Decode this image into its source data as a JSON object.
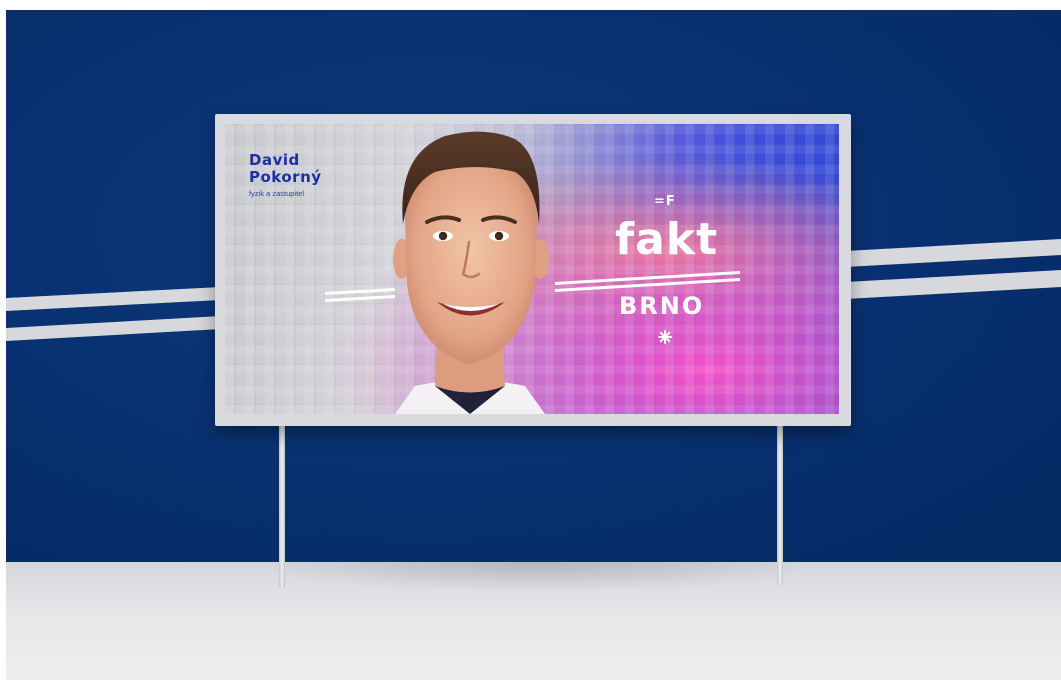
{
  "billboard": {
    "name_line_1": "David",
    "name_line_2": "Pokorný",
    "subtitle": "fyzik a zastupitel",
    "logo_mark": "=F",
    "headline": "fakt",
    "city": "BRNO"
  },
  "colors": {
    "wall": "#083070",
    "floor": "#e2e3e5",
    "frame": "#d9dadd",
    "name_text": "#1b2fa8",
    "gradient_pink": "#f05ac8",
    "gradient_blue": "#2a45d6"
  },
  "icons": {
    "asterisk": "asterisk-icon",
    "logo": "fakt-logo-mark"
  }
}
